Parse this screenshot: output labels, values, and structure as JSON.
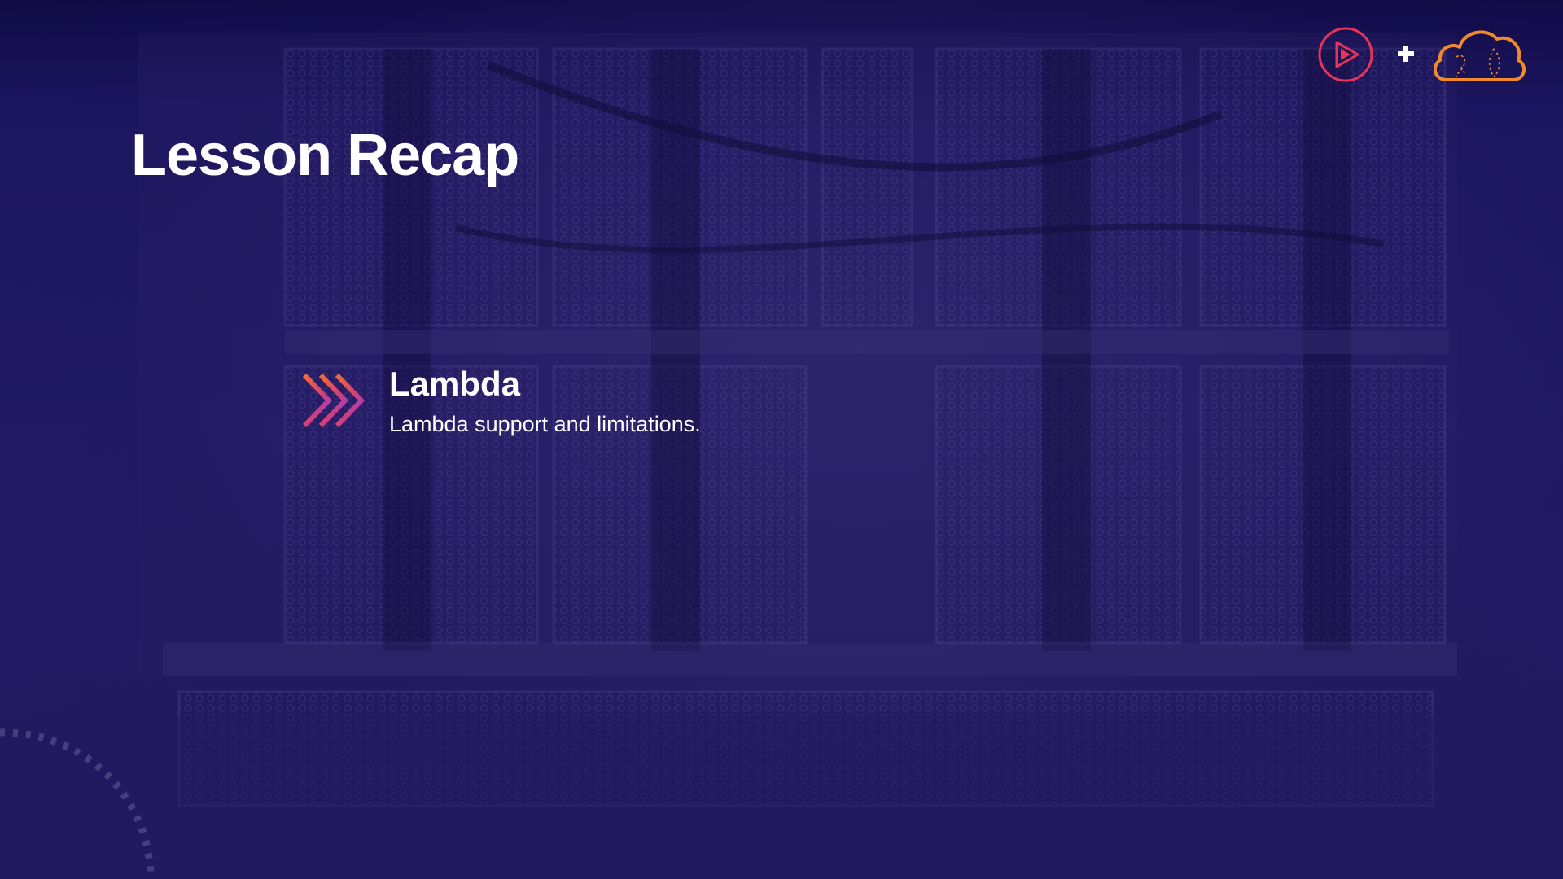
{
  "slide": {
    "title": "Lesson Recap"
  },
  "recap_items": [
    {
      "heading": "Lambda",
      "description": "Lambda support and limitations.",
      "icon": "triple-chevron-right-icon"
    }
  ],
  "branding": {
    "left_logo_icon": "play-logo-icon",
    "separator_icon": "plus-icon",
    "right_logo_icon": "cloud-logo-icon"
  },
  "colors": {
    "background": "#221a66",
    "title_text": "#ffffff",
    "chevron_gradient_start": "#f26b3a",
    "chevron_gradient_end": "#8e3fd6",
    "play_logo": "#e8345a",
    "cloud_logo": "#f08a2a"
  }
}
